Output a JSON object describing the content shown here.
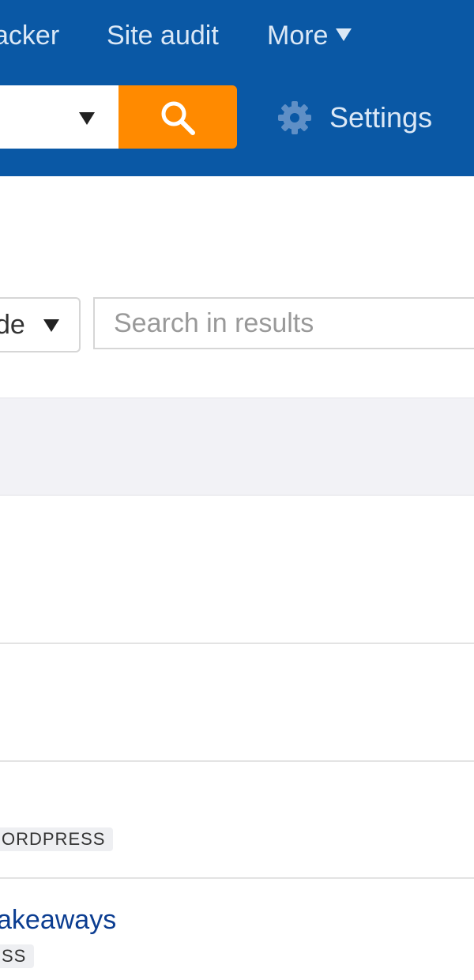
{
  "nav": {
    "items": [
      "acker",
      "Site audit",
      "More"
    ]
  },
  "search": {
    "button_icon": "search-icon",
    "settings_icon": "gear-icon",
    "settings_label": "Settings"
  },
  "filters": {
    "mode_value": "de",
    "search_placeholder": "Search in results"
  },
  "rows": [
    {
      "tag": "ORDPRESS"
    },
    {
      "title": "akeaways",
      "tag": "SS"
    }
  ],
  "colors": {
    "topbar": "#0a58a5",
    "search_button": "#ff8a00",
    "link": "#0b3d91"
  }
}
